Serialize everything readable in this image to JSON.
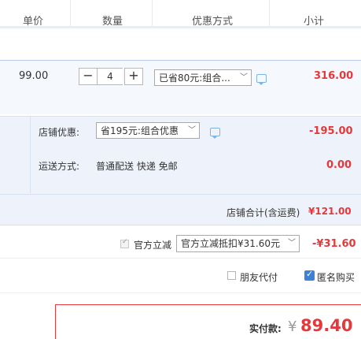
{
  "header": {
    "col_price": "单价",
    "col_quantity": "数量",
    "col_discount": "优惠方式",
    "col_subtotal": "小计"
  },
  "product": {
    "price": "99.00",
    "quantity": "4",
    "discount_select": "已省80元:组合...",
    "subtotal": "316.00"
  },
  "shop": {
    "discount_label": "店铺优惠:",
    "discount_select": "省195元:组合优惠",
    "discount_value": "-195.00",
    "shipping_label": "运送方式:",
    "shipping_value": "普通配送 快递 免邮",
    "shipping_fee": "0.00",
    "total_label": "店铺合计(含运费)",
    "total_value": "¥121.00"
  },
  "official": {
    "label": "官方立减",
    "select": "官方立减抵扣¥31.60元",
    "value": "-¥31.60"
  },
  "options": {
    "friend_pay_label": "朋友代付",
    "anonymous_label": "匿名购买"
  },
  "payment": {
    "label": "实付款:",
    "currency": "¥",
    "amount": "89.40"
  },
  "colors": {
    "accent_red": "#e4393c",
    "checkbox_blue": "#3d80d6",
    "row_bg": "#eef3fb"
  }
}
